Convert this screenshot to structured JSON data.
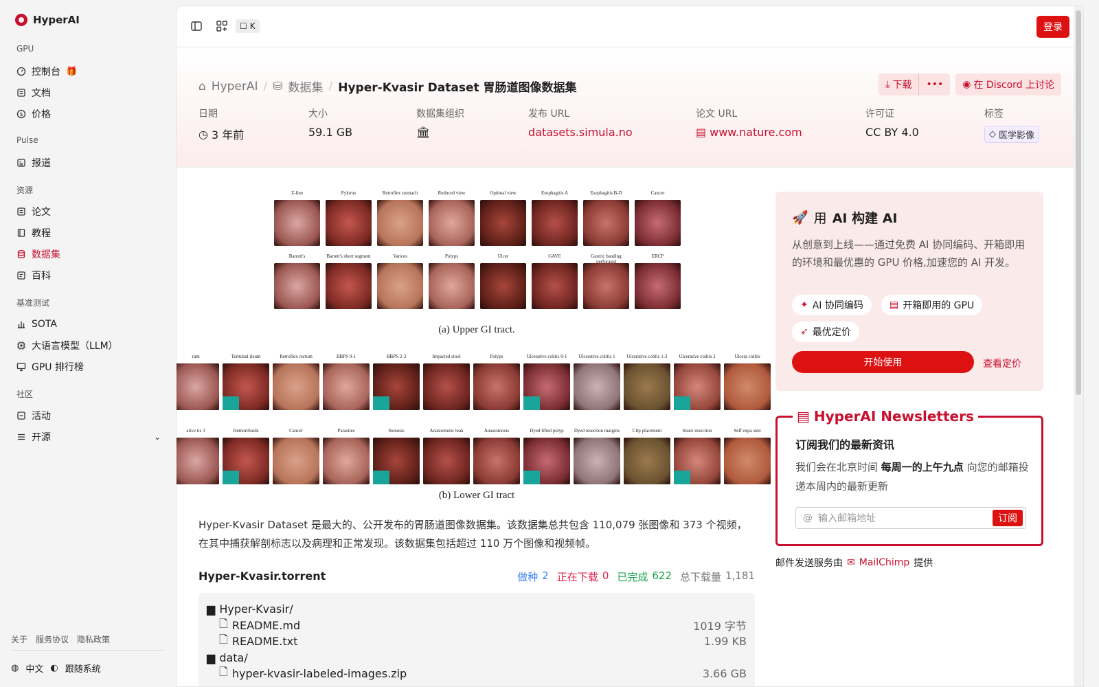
{
  "app": {
    "title": "HyperAI"
  },
  "sidebar": {
    "sections": [
      {
        "label": "GPU"
      },
      {
        "label": "Pulse"
      },
      {
        "label": "资源"
      },
      {
        "label": "基准测试"
      },
      {
        "label": "社区"
      }
    ],
    "items": [
      {
        "label": "控制台",
        "icon": "gauge-icon"
      },
      {
        "label": "文档",
        "icon": "doc-icon"
      },
      {
        "label": "价格",
        "icon": "dollar-icon"
      },
      {
        "label": "报道",
        "icon": "news-icon"
      },
      {
        "label": "论文",
        "icon": "paper-icon"
      },
      {
        "label": "教程",
        "icon": "book-icon"
      },
      {
        "label": "数据集",
        "icon": "database-icon"
      },
      {
        "label": "百科",
        "icon": "wiki-icon"
      },
      {
        "label": "SOTA",
        "icon": "bar-chart-icon"
      },
      {
        "label": "大语言模型（LLM）",
        "icon": "chip-icon"
      },
      {
        "label": "GPU 排行榜",
        "icon": "monitor-icon"
      },
      {
        "label": "活动",
        "icon": "activity-icon"
      },
      {
        "label": "开源",
        "icon": "list-icon"
      }
    ],
    "footer_links": [
      "关于",
      "服务协议",
      "隐私政策"
    ],
    "language": "中文",
    "theme": "跟随系统"
  },
  "topbar": {
    "shortcut_key": "K",
    "login_label": "登录"
  },
  "breadcrumb": {
    "home": "HyperAI",
    "section": "数据集",
    "current": "Hyper-Kvasir Dataset 胃肠道图像数据集"
  },
  "actions": {
    "download": "下载",
    "discord": "在 Discord 上讨论"
  },
  "meta": {
    "date_label": "日期",
    "date_value": "3 年前",
    "size_label": "大小",
    "size_value": "59.1 GB",
    "org_label": "数据集组织",
    "publish_label": "发布 URL",
    "publish_value": "datasets.simula.no",
    "paper_label": "论文 URL",
    "paper_value": "www.nature.com",
    "license_label": "许可证",
    "license_value": "CC BY 4.0",
    "tags_label": "标签",
    "tag_value": "医学影像"
  },
  "figure": {
    "upper_row1": [
      "Z-line",
      "Pylorus",
      "Retroflex stomach",
      "Reduced view",
      "Optimal view",
      "Esophagitis A",
      "Esophagitis B-D",
      "Cancer"
    ],
    "upper_row2": [
      "Barrett's",
      "Barrett's short segment",
      "Varices",
      "Polyps",
      "Ulcer",
      "GAVE",
      "Gastric banding perforated",
      "ERCP"
    ],
    "upper_caption": "(a) Upper GI tract.",
    "lower_row1": [
      "rum",
      "Terminal ileum",
      "Retroflex rectum",
      "BBPS 0-1",
      "BBPS 2-3",
      "Impacted stool",
      "Polyps",
      "Ulcerative colitis 0-1",
      "Ulcerative colitis 1",
      "Ulcerative colitis 1-2",
      "Ulcerative colitis 2",
      "Ulcera colitis"
    ],
    "lower_row2": [
      "ative tis 3",
      "Hemorrhoids",
      "Cancer",
      "Parasites",
      "Stenosis",
      "Anastomotic leak",
      "Anastomosis",
      "Dyed lifted polyp",
      "Dyed resection margins",
      "Clip placement",
      "Snare resection",
      "Self expa sten"
    ],
    "lower_caption": "(b) Lower GI tract"
  },
  "description": "Hyper-Kvasir Dataset 是最大的、公开发布的胃肠道图像数据集。该数据集总共包含 110,079 张图像和 373 个视频，在其中捕获解剖标志以及病理和正常发现。该数据集包括超过 110 万个图像和视频帧。",
  "torrent": {
    "title": "Hyper-Kvasir.torrent",
    "seeds_label": "做种",
    "seeds": "2",
    "downloading_label": "正在下载",
    "downloading": "0",
    "completed_label": "已完成",
    "completed": "622",
    "total_label": "总下载量",
    "total": "1,181",
    "files": [
      {
        "name": "Hyper-Kvasir/",
        "type": "folder",
        "size": ""
      },
      {
        "name": "README.md",
        "type": "file",
        "size": "1019 字节"
      },
      {
        "name": "README.txt",
        "type": "file",
        "size": "1.99 KB"
      },
      {
        "name": "data/",
        "type": "folder",
        "size": ""
      },
      {
        "name": "hyper-kvasir-labeled-images.zip",
        "type": "file",
        "size": "3.66 GB"
      }
    ]
  },
  "promo": {
    "title_prefix": "用",
    "title_bold": "AI 构建 AI",
    "body": "从创意到上线——通过免费 AI 协同编码、开箱即用的环境和最优惠的 GPU 价格,加速您的 AI 开发。",
    "chip1": "AI 协同编码",
    "chip2": "开箱即用的 GPU",
    "chip3": "最优定价",
    "start": "开始使用",
    "pricing": "查看定价"
  },
  "newsletter": {
    "title": "HyperAI Newsletters",
    "subtitle": "订阅我们的最新资讯",
    "body_pre": "我们会在北京时间 ",
    "body_bold": "每周一的上午九点",
    "body_post": " 向您的邮箱投递本周内的最新更新",
    "placeholder": "输入邮箱地址",
    "button": "订阅"
  },
  "mail_note": {
    "pre": "邮件发送服务由",
    "brand": "MailChimp",
    "post": "提供"
  },
  "colors": {
    "accent": "#c8102e",
    "button": "#dd1111"
  }
}
